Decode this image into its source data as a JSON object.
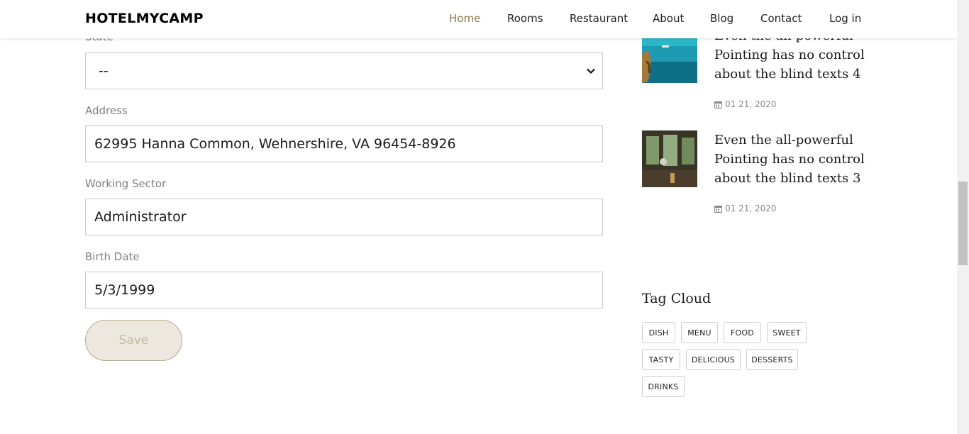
{
  "header": {
    "logo": "HOTELMYCAMP",
    "nav": [
      "Home",
      "Rooms",
      "Restaurant",
      "About",
      "Blog",
      "Contact",
      "Log in"
    ],
    "active_nav": "Home"
  },
  "form": {
    "state_label": "State",
    "state_value": "--",
    "address_label": "Address",
    "address_value": "62995 Hanna Common, Wehnershire, VA 96454-8926",
    "sector_label": "Working Sector",
    "sector_value": "Administrator",
    "birth_label": "Birth Date",
    "birth_value": "5/3/1999",
    "save_label": "Save"
  },
  "sidebar": {
    "posts": [
      {
        "title": "Even the all-powerful Pointing has no control about the blind texts 4",
        "date": "01 21, 2020"
      },
      {
        "title": "Even the all-powerful Pointing has no control about the blind texts 3",
        "date": "01 21, 2020"
      }
    ],
    "tag_cloud_title": "Tag Cloud",
    "tags": [
      "DISH",
      "MENU",
      "FOOD",
      "SWEET",
      "TASTY",
      "DELICIOUS",
      "DESSERTS",
      "DRINKS"
    ]
  },
  "colors": {
    "accent": "#8c7a50",
    "save_bg": "#ede8df",
    "save_border": "#b7a78c"
  }
}
